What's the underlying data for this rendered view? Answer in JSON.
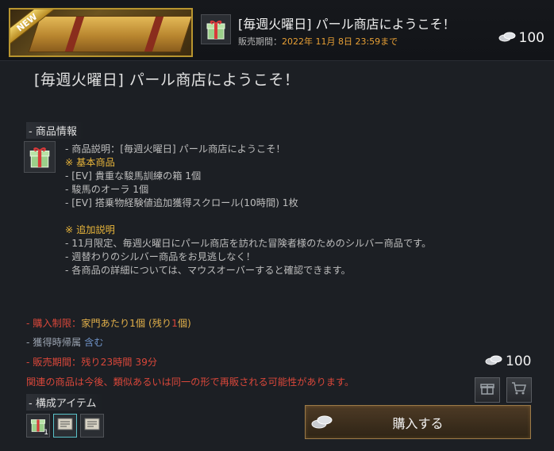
{
  "header": {
    "new_badge": "NEW",
    "title": "[毎週火曜日] パール商店にようこそ！",
    "sale_label": "販売期間：",
    "sale_date": "2022年 11月 8日 23:59まで",
    "price": "100"
  },
  "main_title": "[毎週火曜日] パール商店にようこそ！",
  "product_info": {
    "header": "- 商品情報",
    "lines": [
      "- 商品説明：[毎週火曜日] パール商店にようこそ！",
      "※ 基本商品",
      "- [EV] 貴重な駿馬訓練の箱 1個",
      "- 駿馬のオーラ 1個",
      "- [EV] 搭乗物経験値追加獲得スクロール(10時間) 1枚",
      "",
      "※ 追加説明",
      "- 11月限定、毎週火曜日にパール商店を訪れた冒険者様のためのシルバー商品です。",
      "- 週替わりのシルバー商品をお見逃しなく！",
      "- 各商品の詳細については、マウスオーバーすると確認できます。"
    ]
  },
  "limits": {
    "purchase_limit_label": "- 購入制限：",
    "purchase_limit_value": "家門あたり1個 (残り",
    "purchase_limit_remaining": "1",
    "purchase_limit_end": "個)",
    "bind_label": "- 獲得時帰属 ",
    "bind_value": "含む",
    "sale_period_label": "- 販売期間：",
    "sale_period_value": "残り23時間 39分"
  },
  "resale_note": "関連の商品は今後、類似あるいは同一の形で再販される可能性があります。",
  "components": {
    "header": "- 構成アイテム",
    "items": [
      {
        "icon": "gift-box-icon",
        "qty": "1"
      },
      {
        "icon": "scroll-icon",
        "qty": ""
      },
      {
        "icon": "scroll-icon",
        "qty": ""
      }
    ]
  },
  "purchase": {
    "price": "100",
    "buy_label": "購入する",
    "gift_icon": "gift-icon",
    "cart_icon": "cart-icon"
  },
  "colors": {
    "accent_gold": "#e8b53a",
    "warning_red": "#d9473a",
    "bind_blue": "#6f92c6"
  }
}
